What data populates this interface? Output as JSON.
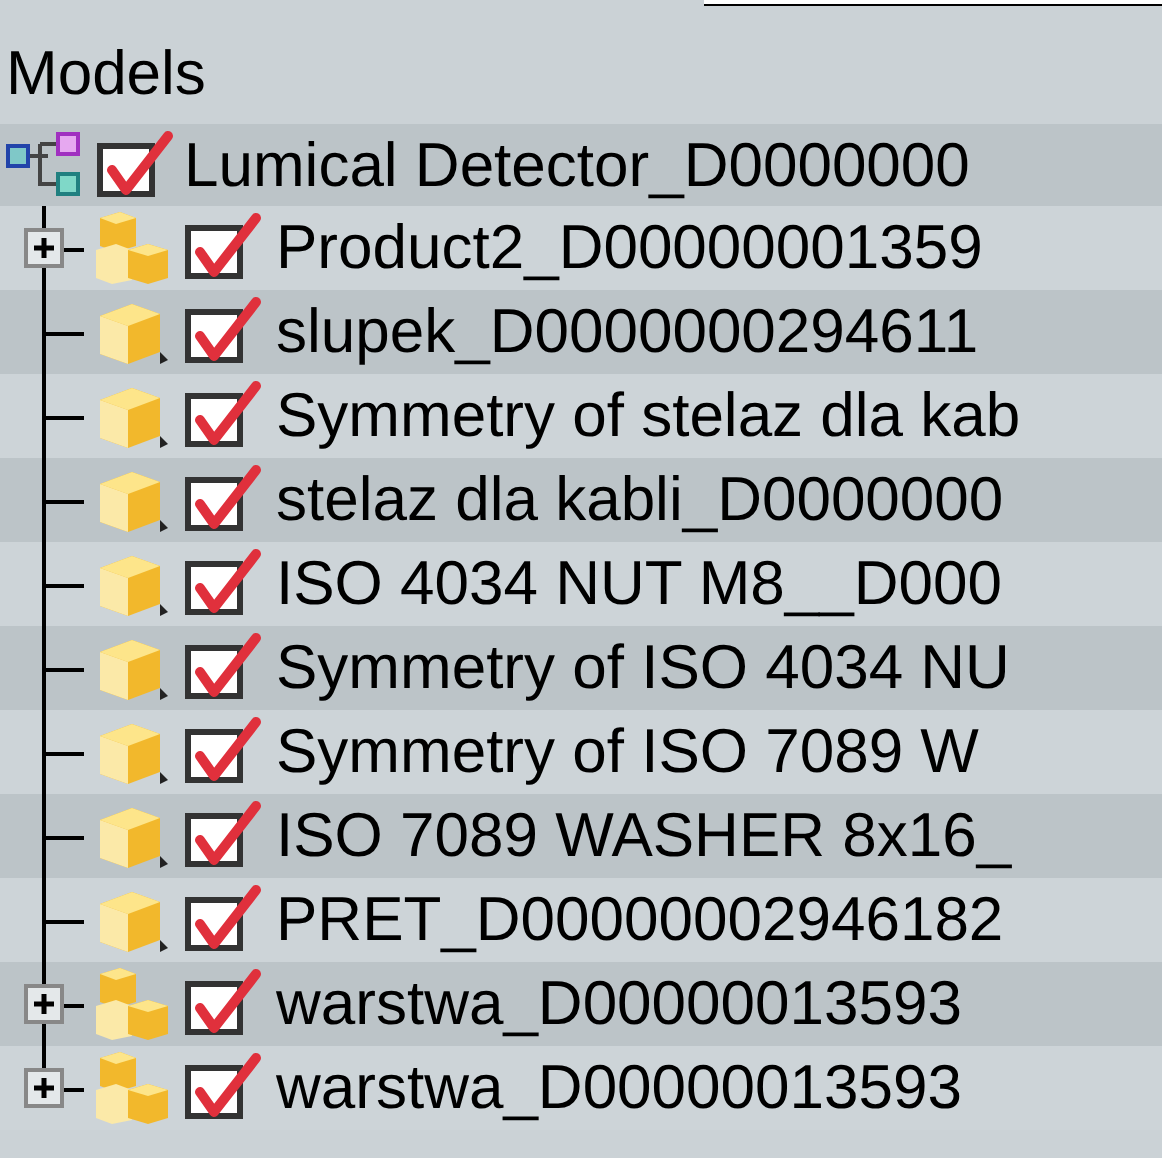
{
  "panel": {
    "title": "Models"
  },
  "tree": [
    {
      "label": "Lumical Detector_D0000000",
      "kind": "root",
      "checked": true,
      "children": [
        {
          "label": "Product2_D00000001359",
          "kind": "assembly",
          "checked": true,
          "expanded": false
        },
        {
          "label": "slupek_D0000000294611",
          "kind": "part",
          "checked": true
        },
        {
          "label": "Symmetry of stelaz dla kab",
          "kind": "part",
          "checked": true
        },
        {
          "label": "stelaz dla kabli_D0000000",
          "kind": "part",
          "checked": true
        },
        {
          "label": "ISO 4034 NUT M8__D000",
          "kind": "part",
          "checked": true
        },
        {
          "label": "Symmetry of ISO 4034 NU",
          "kind": "part",
          "checked": true
        },
        {
          "label": "Symmetry of ISO 7089 W",
          "kind": "part",
          "checked": true
        },
        {
          "label": "ISO 7089 WASHER 8x16_",
          "kind": "part",
          "checked": true
        },
        {
          "label": "PRET_D00000002946182",
          "kind": "part",
          "checked": true
        },
        {
          "label": "warstwa_D00000013593",
          "kind": "assembly",
          "checked": true,
          "expanded": false
        },
        {
          "label": "warstwa_D00000013593",
          "kind": "assembly",
          "checked": true,
          "expanded": false
        }
      ]
    }
  ]
}
